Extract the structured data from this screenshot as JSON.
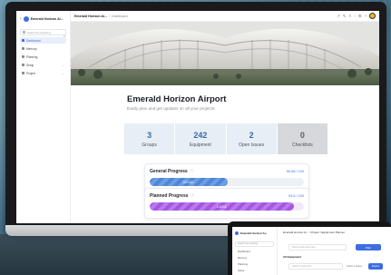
{
  "desktop": {
    "sidebar": {
      "back_icon": "chevron-left-icon",
      "org_title": "Emerald Horizon Ai...",
      "search_placeholder": "Search by anything",
      "collapse_icon": "sidebar-collapse-icon",
      "items": [
        {
          "label": "Dashboard",
          "icon": "dashboard-icon",
          "active": true
        },
        {
          "label": "Memory",
          "icon": "memory-icon",
          "active": false
        },
        {
          "label": "Planning",
          "icon": "planning-icon",
          "active": false
        },
        {
          "label": "Setup",
          "icon": "setup-icon",
          "active": false,
          "expandable": true
        },
        {
          "label": "Project",
          "icon": "project-icon",
          "active": false,
          "expandable": true
        }
      ]
    },
    "topbar": {
      "crumb_root": "Emerald Horizon Ai...",
      "crumb_separator": "/",
      "crumb_current": "Dashboard",
      "icons": [
        "external-link-icon",
        "edit-icon",
        "share-icon",
        "pin-icon",
        "settings-icon",
        "bell-icon",
        "avatar"
      ]
    },
    "page": {
      "title": "Emerald Horizon Airport",
      "subtitle": "Easily plan and get updates on all your projects."
    },
    "stats": [
      {
        "value": "3",
        "label": "Groups"
      },
      {
        "value": "242",
        "label": "Equipment"
      },
      {
        "value": "2",
        "label": "Open Issues"
      },
      {
        "value": "0",
        "label": "Checklists"
      }
    ],
    "progress": [
      {
        "title": "General Progress",
        "info_icon": "info-icon",
        "value_text": "50.65 / 100",
        "fill_label": "DEVAL",
        "fraction": 0.5065,
        "color": "#4f86d6"
      },
      {
        "title": "Planned Progress",
        "info_icon": "info-icon",
        "value_text": "93.6 / 100",
        "fill_label": "LAGA",
        "fraction": 0.936,
        "color": "#a456e0"
      }
    ]
  },
  "laptop": {
    "org_title": "Emerald Horizon Ai...",
    "search_placeholder": "Search by anything",
    "sidebar_items": [
      "Dashboard",
      "Memory",
      "Planning",
      "Setup"
    ],
    "crumbs": "Emerald Horizon Ai... / Project / Equipment Planner",
    "input1_placeholder": "Name equipment here",
    "button1": "Filter",
    "section_title": "All Equipment",
    "input2_placeholder": "Search equipment",
    "select_value": "Select a status",
    "button2": "Export"
  },
  "colors": {
    "accent": "#3d6ee0",
    "stat_value": "#3a6aa8",
    "progress_blue": "#4f86d6",
    "progress_purple": "#a456e0"
  }
}
